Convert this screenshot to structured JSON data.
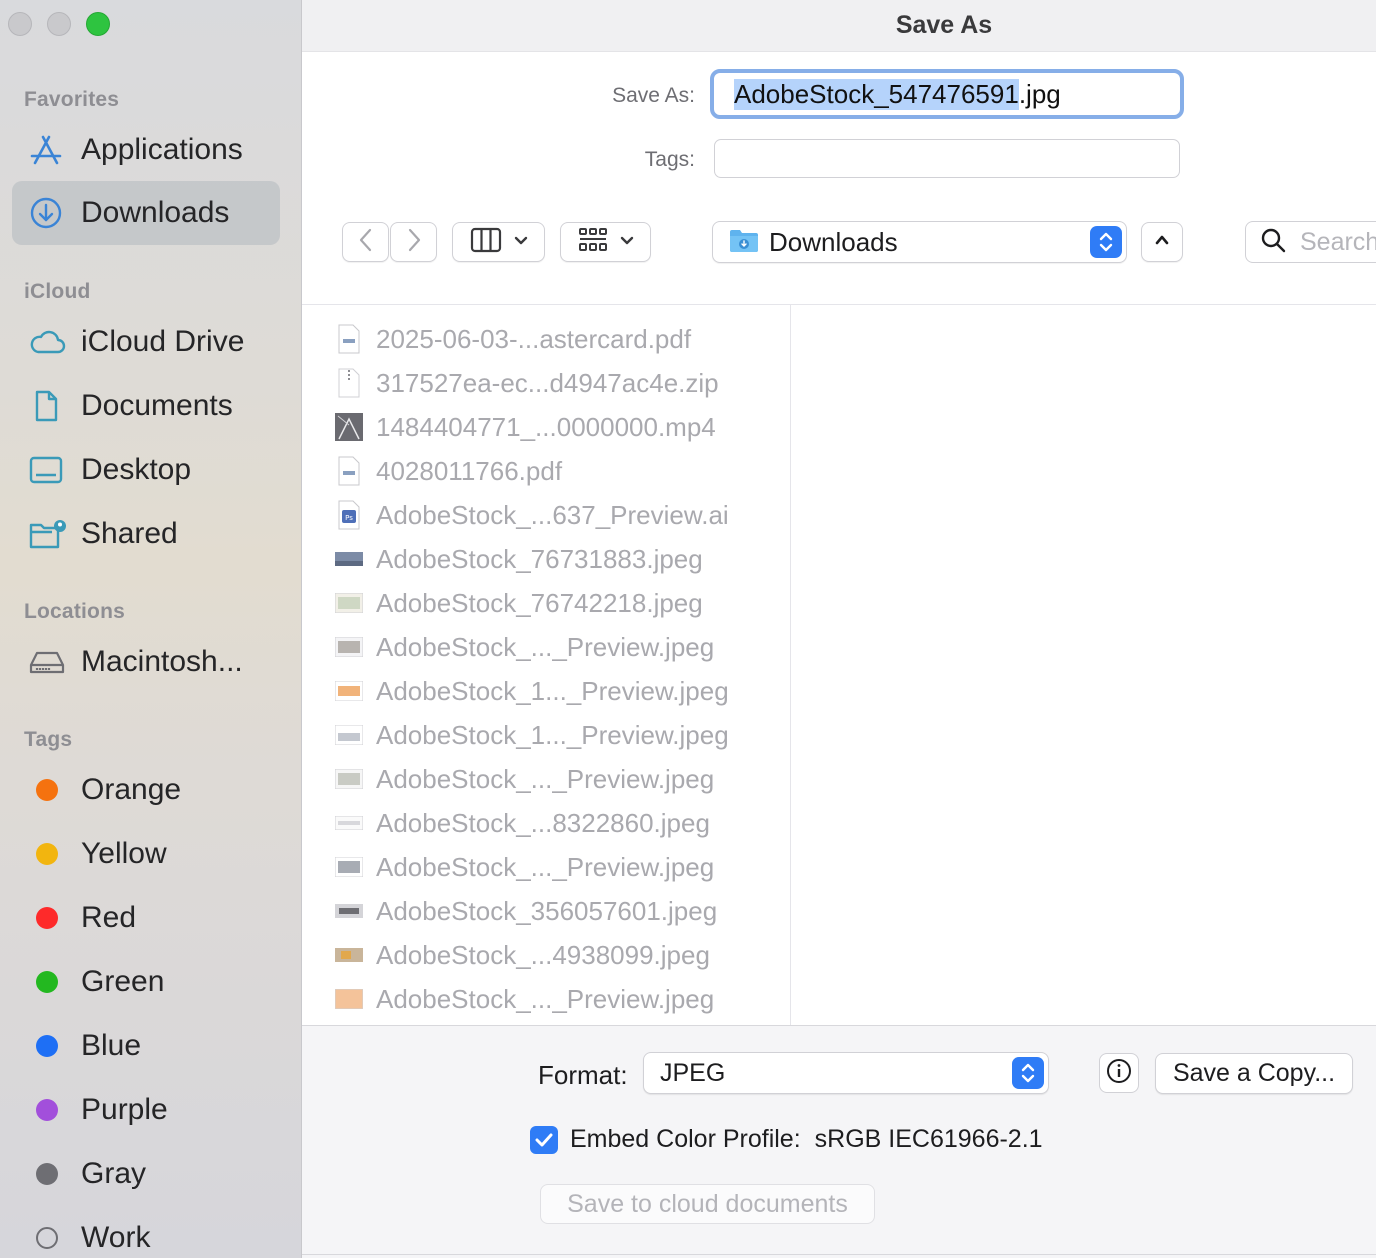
{
  "window": {
    "title": "Save As"
  },
  "sidebar": {
    "favorites_header": "Favorites",
    "favorites": [
      {
        "label": "Applications",
        "icon": "applications-icon"
      },
      {
        "label": "Downloads",
        "icon": "downloads-icon",
        "selected": true
      }
    ],
    "icloud_header": "iCloud",
    "icloud": [
      {
        "label": "iCloud Drive",
        "icon": "icloud-icon"
      },
      {
        "label": "Documents",
        "icon": "document-icon"
      },
      {
        "label": "Desktop",
        "icon": "desktop-icon"
      },
      {
        "label": "Shared",
        "icon": "shared-folder-icon"
      }
    ],
    "locations_header": "Locations",
    "locations": [
      {
        "label": "Macintosh...",
        "icon": "hard-drive-icon"
      }
    ],
    "tags_header": "Tags",
    "tags": [
      {
        "label": "Orange",
        "color": "#f5720f"
      },
      {
        "label": "Yellow",
        "color": "#f2b50f"
      },
      {
        "label": "Red",
        "color": "#fe2a2a"
      },
      {
        "label": "Green",
        "color": "#23b820"
      },
      {
        "label": "Blue",
        "color": "#1e6ff5"
      },
      {
        "label": "Purple",
        "color": "#a24fdb"
      },
      {
        "label": "Gray",
        "color": "#6e6e73"
      },
      {
        "label": "Work",
        "color": ""
      }
    ]
  },
  "form": {
    "save_as_label": "Save As:",
    "filename_selected": "AdobeStock_547476591",
    "filename_ext": ".jpg",
    "tags_label": "Tags:",
    "tags_value": ""
  },
  "toolbar": {
    "location": "Downloads",
    "search_placeholder": "Search"
  },
  "files": [
    {
      "name": "2025-06-03-...astercard.pdf",
      "icon": "pdf-file-icon"
    },
    {
      "name": "317527ea-ec...d4947ac4e.zip",
      "icon": "zip-file-icon"
    },
    {
      "name": "1484404771_...0000000.mp4",
      "icon": "video-file-icon"
    },
    {
      "name": "4028011766.pdf",
      "icon": "pdf-file-icon"
    },
    {
      "name": "AdobeStock_...637_Preview.ai",
      "icon": "ai-file-icon"
    },
    {
      "name": "AdobeStock_76731883.jpeg",
      "icon": "image-file-icon"
    },
    {
      "name": "AdobeStock_76742218.jpeg",
      "icon": "image-file-icon"
    },
    {
      "name": "AdobeStock_..._Preview.jpeg",
      "icon": "image-file-icon"
    },
    {
      "name": "AdobeStock_1..._Preview.jpeg",
      "icon": "image-file-icon"
    },
    {
      "name": "AdobeStock_1..._Preview.jpeg",
      "icon": "image-file-icon"
    },
    {
      "name": "AdobeStock_..._Preview.jpeg",
      "icon": "image-file-icon"
    },
    {
      "name": "AdobeStock_...8322860.jpeg",
      "icon": "image-file-icon"
    },
    {
      "name": "AdobeStock_..._Preview.jpeg",
      "icon": "image-file-icon"
    },
    {
      "name": "AdobeStock_356057601.jpeg",
      "icon": "image-file-icon"
    },
    {
      "name": "AdobeStock_...4938099.jpeg",
      "icon": "image-file-icon"
    },
    {
      "name": "AdobeStock_..._Preview.jpeg",
      "icon": "image-file-icon"
    }
  ],
  "bottom": {
    "format_label": "Format:",
    "format_value": "JPEG",
    "save_copy_label": "Save a Copy...",
    "embed_label": "Embed Color Profile:",
    "embed_value": "sRGB IEC61966-2.1",
    "embed_checked": true,
    "cloud_label": "Save to cloud documents"
  },
  "colors": {
    "accent": "#2f7cf6",
    "sidebar_icon": "#3a84d6",
    "selection": "#b5d3fb"
  }
}
